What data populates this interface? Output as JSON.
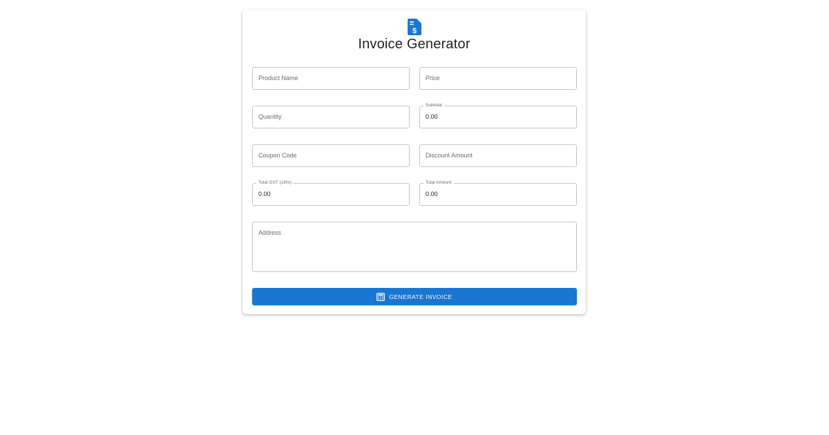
{
  "header": {
    "icon": "invoice-dollar-icon",
    "title": "Invoice Generator"
  },
  "form": {
    "product_name": {
      "placeholder": "Product Name",
      "value": ""
    },
    "price": {
      "placeholder": "Price",
      "value": ""
    },
    "quantity": {
      "placeholder": "Quantity",
      "value": ""
    },
    "subtotal": {
      "label": "Subtotal",
      "value": "0.00"
    },
    "coupon_code": {
      "placeholder": "Coupon Code",
      "value": ""
    },
    "discount_amount": {
      "placeholder": "Discount Amount",
      "value": ""
    },
    "total_gst": {
      "label": "Total GST (18%)",
      "value": "0.00"
    },
    "total_amount": {
      "label": "Total Amount",
      "value": "0.00"
    },
    "address": {
      "placeholder": "Address",
      "value": ""
    }
  },
  "actions": {
    "generate_label": "GENERATE INVOICE",
    "generate_icon": "calculator-icon"
  },
  "colors": {
    "primary": "#1976d2",
    "border": "#c4c4c4",
    "text": "#212121",
    "muted": "#6b6b6b"
  }
}
